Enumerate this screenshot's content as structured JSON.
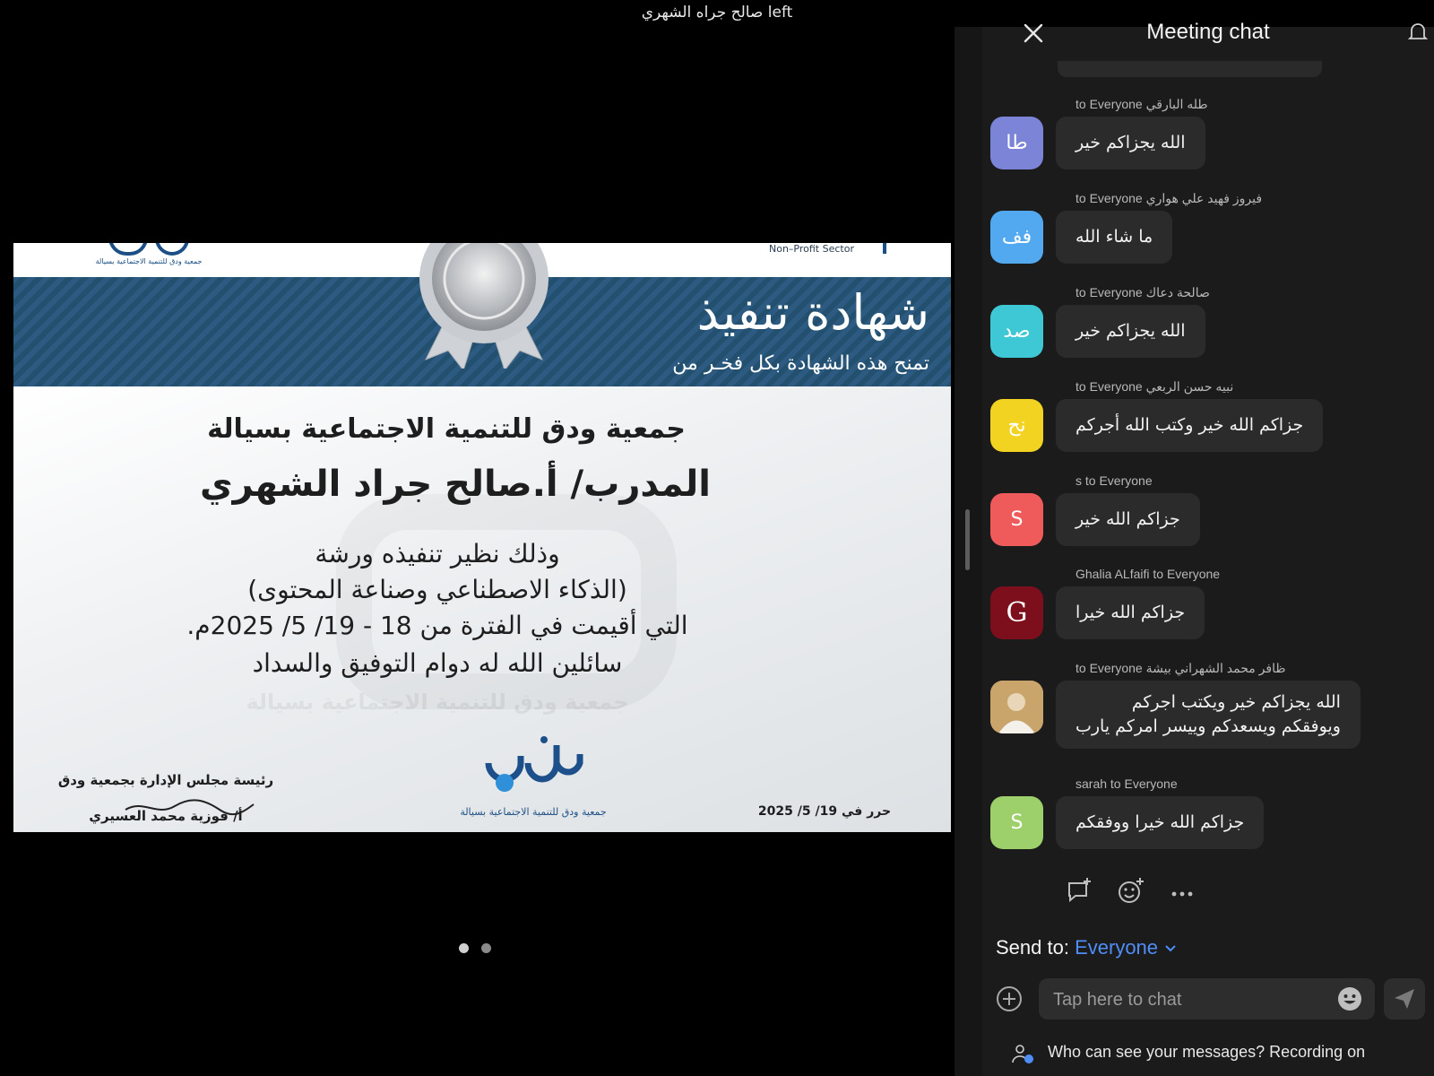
{
  "notice": "صالح جراه الشهري left",
  "slide": {
    "brand_caption_top": "جمعية ودق للتنمية الاجتماعية بسيالة",
    "sector_label": "Non–Profit Sector",
    "title": "شهادة تنفيذ",
    "subtitle": "تمنح هذه الشهادة بكل فخـر من",
    "org_line": "جمعية ودق للتنمية الاجتماعية بسيالة",
    "trainer_line": "المدرب/ أ.صالح جراد الشهري",
    "body_line1": "وذلك نظير تنفيذه ورشة",
    "body_line2": "(الذكاء الاصطناعي وصناعة المحتوى)",
    "body_line3": "التي أقيمت في الفترة من 18 - 19/ 5/ 2025م.",
    "body_line4": "سائلين الله له دوام التوفيق والسداد",
    "watermark_text": "جمعية ودق للتنمية الاجتماعية بسيالة",
    "logo_bottom_caption": "جمعية ودق للتنمية الاجتماعية بسيالة",
    "signatory_title": "رئيسة مجلس الإدارة بجمعية ودق",
    "signatory_name": "أ/ فوزية محمد العسيري",
    "issued_date": "حرر في 19/ 5/ 2025"
  },
  "pager": {
    "count": 2,
    "active_index": 0
  },
  "chat": {
    "title": "Meeting chat",
    "messages": [
      {
        "meta": "to Everyone طله البارقي",
        "avatar": "طا",
        "avatar_color": "#7b84d6",
        "text": "الله يجزاكم خير"
      },
      {
        "meta": "to Everyone فيروز فهيد علي هواري",
        "avatar": "فف",
        "avatar_color": "#53a9f0",
        "text": "ما شاء الله"
      },
      {
        "meta": "to Everyone صالحة دعاك",
        "avatar": "صد",
        "avatar_color": "#3ec8d6",
        "text": "الله يجزاكم خير"
      },
      {
        "meta": "to Everyone نبيه حسن الربعي",
        "avatar": "نح",
        "avatar_color": "#f2d322",
        "text": "جزاكم الله خير وكتب الله أجركم"
      },
      {
        "meta": "s to Everyone",
        "avatar": "S",
        "avatar_color": "#ef5b5b",
        "text": "جزاكم الله خير"
      },
      {
        "meta": "Ghalia ALfaifi to Everyone",
        "avatar": "G",
        "avatar_color": "#7d0e1c",
        "text": "جزاكم الله خيرا"
      },
      {
        "meta": "to Everyone ظافر محمد الشهراني بيشة",
        "avatar": "",
        "avatar_color": "#c2a06b",
        "text": "الله يجزاكم خير ويكتب اجركم",
        "text2": "ويوفقكم ويسعدكم وييسر امركم يارب"
      },
      {
        "meta": "sarah to Everyone",
        "avatar": "S",
        "avatar_color": "#9dd06b",
        "text": "جزاكم الله خيرا ووفقكم"
      }
    ],
    "send_to_label": "Send to:",
    "send_to_target": "Everyone",
    "input_placeholder": "Tap here to chat",
    "privacy_text": "Who can see your messages? Recording on"
  }
}
